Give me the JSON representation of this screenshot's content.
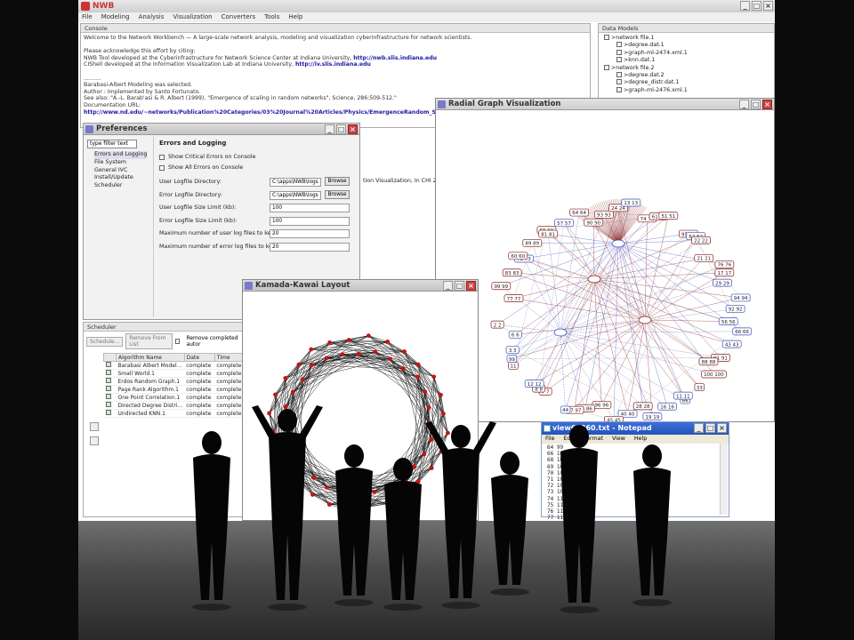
{
  "app": {
    "title": "NWB",
    "menu": [
      "File",
      "Modeling",
      "Analysis",
      "Visualization",
      "Converters",
      "Tools",
      "Help"
    ]
  },
  "console": {
    "tab": "Console",
    "lines": [
      {
        "text": "Welcome to the Network Workbench — A large-scale network analysis, modeling and visualization cyberinfrastructure for network scientists.",
        "link": ""
      },
      {
        "text": "",
        "link": ""
      },
      {
        "text": "Please acknowledge this effort by citing:",
        "link": ""
      },
      {
        "text": "NWB Tool developed at the Cyberinfrastructure for Network Science Center at Indiana University,",
        "link": "http://nwb.slis.indiana.edu"
      },
      {
        "text": "CIShell developed at the Information Visualization Lab at Indiana University,",
        "link": "http://iv.slis.indiana.edu"
      },
      {
        "text": "",
        "link": ""
      },
      {
        "text": "..........",
        "link": ""
      },
      {
        "text": "Barabasi-Albert Modeling was selected.",
        "link": ""
      },
      {
        "text": "Author : Implemented by Santo Fortunato.",
        "link": ""
      },
      {
        "text": "See also: \"A.-L. Barab'asi & R. Albert (1999), \"Emergence of scaling in random networks\", Science, 286:509-512.\"",
        "link": ""
      },
      {
        "text": "Documentation URL:",
        "link": ""
      },
      {
        "text": "",
        "link": "http://www.nd.edu/~networks/Publication%20Categories/03%20Journal%20Articles/Physics/EmergenceRandom_Science"
      }
    ]
  },
  "datamodels": {
    "tab": "Data Models",
    "items": [
      {
        "label": ">network file.1",
        "depth": 0
      },
      {
        "label": ">degree.dat.1",
        "depth": 1
      },
      {
        "label": ">graph-ml-2474.xml.1",
        "depth": 1
      },
      {
        "label": ">knn.dat.1",
        "depth": 1
      },
      {
        "label": ">network file.2",
        "depth": 0
      },
      {
        "label": ">degree.dat.2",
        "depth": 1
      },
      {
        "label": ">degree_distr.dat.1",
        "depth": 1
      },
      {
        "label": ">graph-ml-2476.xml.1",
        "depth": 1
      }
    ]
  },
  "preferences": {
    "title": "Preferences",
    "filter": "type filter text",
    "tree": [
      "Errors and Logging",
      "File System",
      "General IVC",
      "Install/Update",
      "Scheduler"
    ],
    "heading": "Errors and Logging",
    "checkboxes": [
      "Show Critical Errors on Console",
      "Show All Errors on Console"
    ],
    "fields": [
      {
        "label": "User Logfile Directory:",
        "value": "C:\\apps\\NWB\\logs",
        "button": "Browse"
      },
      {
        "label": "Error Logfile Directory:",
        "value": "C:\\apps\\NWB\\logs",
        "button": "Browse"
      },
      {
        "label": "User Logfile Size Limit (kb):",
        "value": "100",
        "button": ""
      },
      {
        "label": "Error Logfile Size Limit (kb):",
        "value": "100",
        "button": ""
      },
      {
        "label": "Maximum number of user log files to keep:",
        "value": "20",
        "button": ""
      },
      {
        "label": "Maximum number of error log files to keep:",
        "value": "20",
        "button": ""
      }
    ],
    "overflow_text": "tion Visualization, In CHI 2005,"
  },
  "scheduler": {
    "tab": "Scheduler",
    "schedule_btn": "Schedule...",
    "remove_btn": "Remove From List",
    "remove_completed": "Remove completed autor",
    "columns": [
      "Algorithm Name",
      "Date",
      "Time"
    ],
    "rows": [
      [
        "Barabasi Albert Model...",
        "complete",
        "complete"
      ],
      [
        "Small World.1",
        "complete",
        "complete"
      ],
      [
        "Erdos Random Graph.1",
        "complete",
        "complete"
      ],
      [
        "Page Rank Algorithm.1",
        "complete",
        "complete"
      ],
      [
        "One Point Correlation.1",
        "complete",
        "complete"
      ],
      [
        "Directed Degree Distri...",
        "complete",
        "complete"
      ],
      [
        "Undirected KNN.1",
        "complete",
        "complete"
      ]
    ]
  },
  "radial": {
    "title": "Radial Graph Visualization",
    "labels": [
      "77 77",
      "99 99",
      "83 83",
      "73 73",
      "60 60",
      "89 89",
      "69 69",
      "81 81",
      "57 57",
      "64 64",
      "90 90",
      "93 93",
      "24 24",
      "13 13",
      "74 74",
      "61 61",
      "51 51",
      "95 95",
      "62 62",
      "22 22",
      "21 21",
      "76 76",
      "17 17",
      "29 29",
      "94 94",
      "92 92",
      "56 56",
      "66 66",
      "43 43",
      "91 91",
      "88 88",
      "100 100",
      "33",
      "66",
      "11 11",
      "16 16",
      "19 19",
      "28 28",
      "40 40",
      "45 45",
      "96 96",
      "86 86",
      "97 97",
      "44",
      "7 7",
      "8 8",
      "12 12",
      "11",
      "99",
      "3 3",
      "6 6",
      "2 2"
    ]
  },
  "kk": {
    "title": "Kamada-Kawai Layout"
  },
  "notepad": {
    "title": "view61360.txt - Notepad",
    "menu": [
      "File",
      "Edit",
      "Format",
      "View",
      "Help"
    ],
    "lines": [
      "64  99",
      "66  102",
      "68  104",
      "69  105",
      "70  106",
      "71  107",
      "72  108",
      "73  109",
      "74  110",
      "75  111",
      "76  112",
      "77  113"
    ]
  },
  "colors": {
    "accent": "#c33333",
    "node": "#cc1111",
    "link": "#1a1aa6",
    "edge_red": "#8b1a1a",
    "edge_blue": "#3a4fbf"
  }
}
